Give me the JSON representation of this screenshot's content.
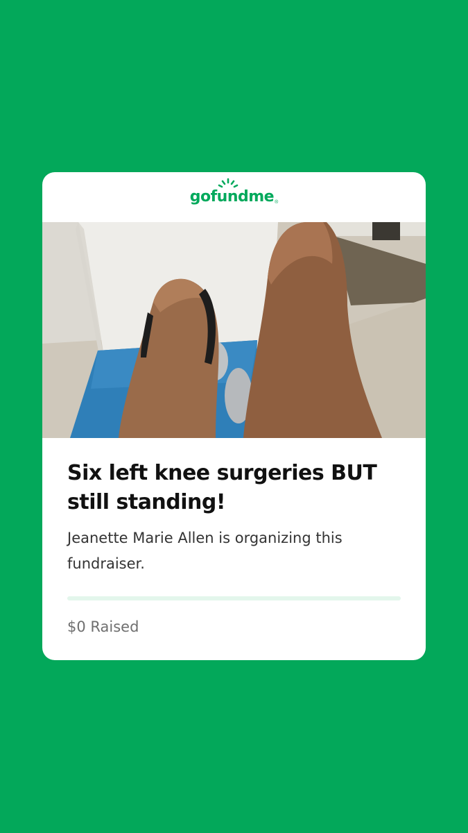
{
  "brand": {
    "logo_text": "gofundme",
    "logo_mark": "®",
    "sun_icon": "sun-rays-icon",
    "color": "#02a95c",
    "background": "#03a85a"
  },
  "campaign": {
    "image_alt": "knees",
    "title": "Six left knee surgeries BUT still standing!",
    "organizer_text": "Jeanette Marie Allen is organizing this fundraiser.",
    "progress_fraction": 0,
    "raised_text": "$0 Raised"
  }
}
